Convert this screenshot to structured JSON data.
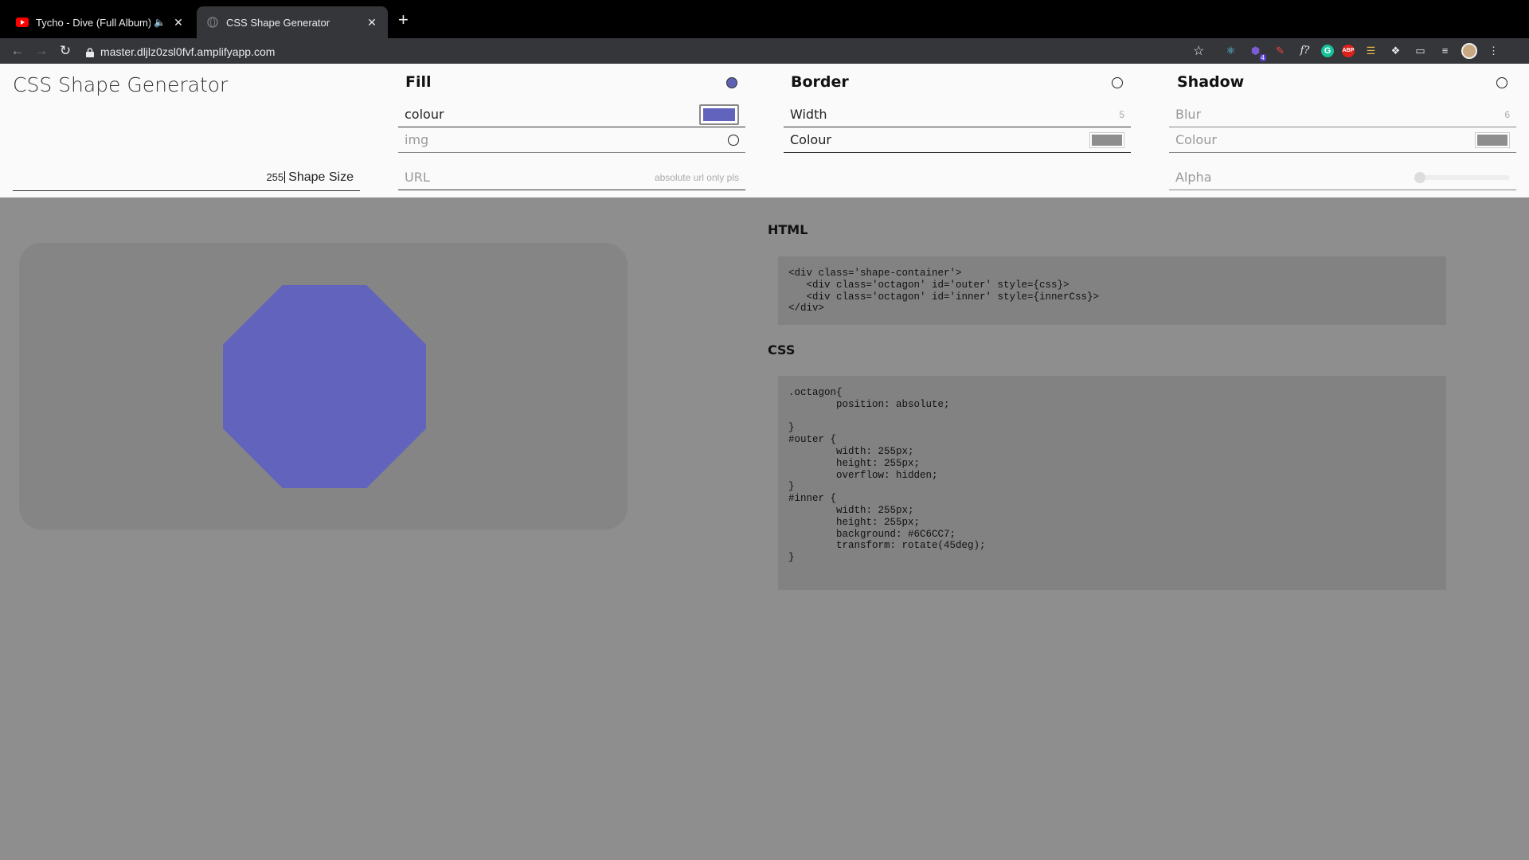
{
  "browser": {
    "tabs": [
      {
        "title": "Tycho - Dive (Full Album) -",
        "favicon": "youtube-icon"
      },
      {
        "title": "CSS Shape Generator",
        "favicon": "globe-icon"
      }
    ],
    "url": "master.dljlz0zsl0fvf.amplifyapp.com",
    "extension_badge": "4"
  },
  "app": {
    "title": "CSS Shape Generator",
    "shape_size_value": "255",
    "shape_size_label": "Shape Size"
  },
  "fill": {
    "title": "Fill",
    "enabled": true,
    "colour_label": "colour",
    "colour_value": "#6C6CC7",
    "img_label": "img",
    "url_placeholder": "URL",
    "url_hint": "absolute url only pls"
  },
  "border": {
    "title": "Border",
    "width_label": "Width",
    "width_value": "5",
    "colour_label": "Colour"
  },
  "shadow": {
    "title": "Shadow",
    "blur_label": "Blur",
    "blur_value": "6",
    "colour_label": "Colour",
    "alpha_label": "Alpha"
  },
  "output": {
    "html_title": "HTML",
    "html_code": "<div class='shape-container'>\n   <div class='octagon' id='outer' style={css}>\n   <div class='octagon' id='inner' style={innerCss}>\n</div>",
    "css_title": "CSS",
    "css_code": ".octagon{\n        position: absolute;\n\n}\n#outer {\n        width: 255px;\n        height: 255px;\n        overflow: hidden;\n}\n#inner {\n        width: 255px;\n        height: 255px;\n        background: #6C6CC7;\n        transform: rotate(45deg);\n}"
  },
  "colors": {
    "shape_fill": "#6163bc",
    "page_bg": "#8e8e8e",
    "panel_bg": "#fafafa"
  }
}
